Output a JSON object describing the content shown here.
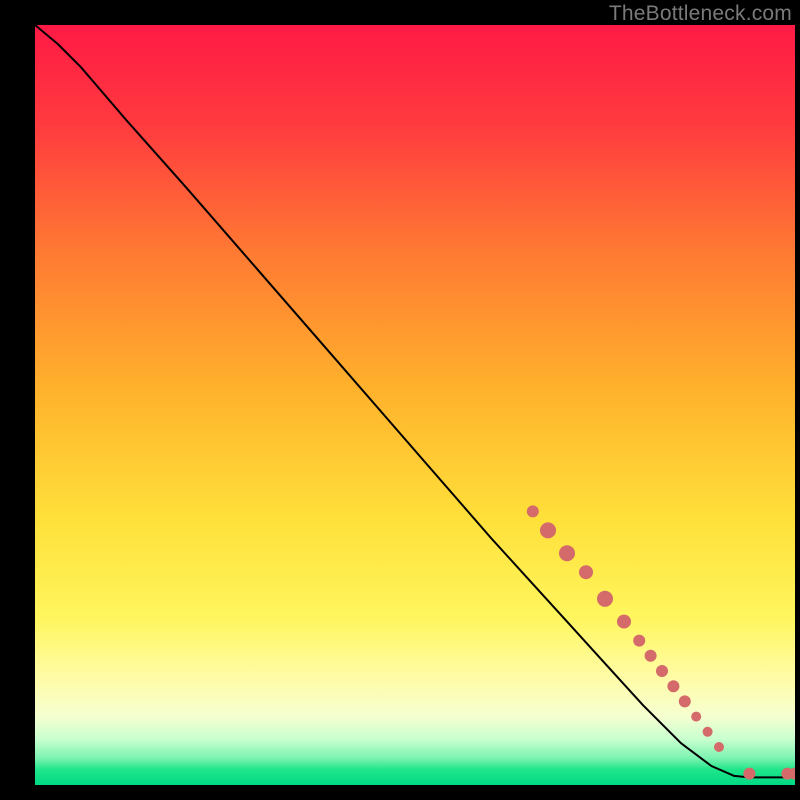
{
  "watermark": "TheBottleneck.com",
  "chart_data": {
    "type": "line",
    "title": "",
    "xlabel": "",
    "ylabel": "",
    "xlim": [
      0,
      100
    ],
    "ylim": [
      0,
      100
    ],
    "background_gradient": [
      "#ff1a45",
      "#ff9b2c",
      "#ffe93a",
      "#fffca8",
      "#1ee68a"
    ],
    "series": [
      {
        "name": "curve",
        "stroke": "#000000",
        "x": [
          0,
          3,
          6,
          9,
          12,
          16,
          20,
          30,
          40,
          50,
          60,
          65,
          70,
          75,
          80,
          85,
          89,
          92,
          94,
          97,
          100
        ],
        "y": [
          100,
          97.5,
          94.5,
          91,
          87.5,
          83,
          78.5,
          67,
          55.5,
          44,
          32.5,
          27,
          21.5,
          16,
          10.5,
          5.5,
          2.5,
          1.2,
          1,
          1,
          1
        ]
      },
      {
        "name": "markers",
        "type": "scatter",
        "color": "#d46a6a",
        "points": [
          {
            "x": 65.5,
            "y": 36,
            "r": 6
          },
          {
            "x": 67.5,
            "y": 33.5,
            "r": 8
          },
          {
            "x": 70,
            "y": 30.5,
            "r": 8
          },
          {
            "x": 72.5,
            "y": 28,
            "r": 7
          },
          {
            "x": 75,
            "y": 24.5,
            "r": 8
          },
          {
            "x": 77.5,
            "y": 21.5,
            "r": 7
          },
          {
            "x": 79.5,
            "y": 19,
            "r": 6
          },
          {
            "x": 81,
            "y": 17,
            "r": 6
          },
          {
            "x": 82.5,
            "y": 15,
            "r": 6
          },
          {
            "x": 84,
            "y": 13,
            "r": 6
          },
          {
            "x": 85.5,
            "y": 11,
            "r": 6
          },
          {
            "x": 87,
            "y": 9,
            "r": 5
          },
          {
            "x": 88.5,
            "y": 7,
            "r": 5
          },
          {
            "x": 90,
            "y": 5,
            "r": 5
          },
          {
            "x": 94,
            "y": 1.5,
            "r": 6
          },
          {
            "x": 99,
            "y": 1.5,
            "r": 6
          },
          {
            "x": 100,
            "y": 1.5,
            "r": 6
          }
        ]
      }
    ]
  }
}
